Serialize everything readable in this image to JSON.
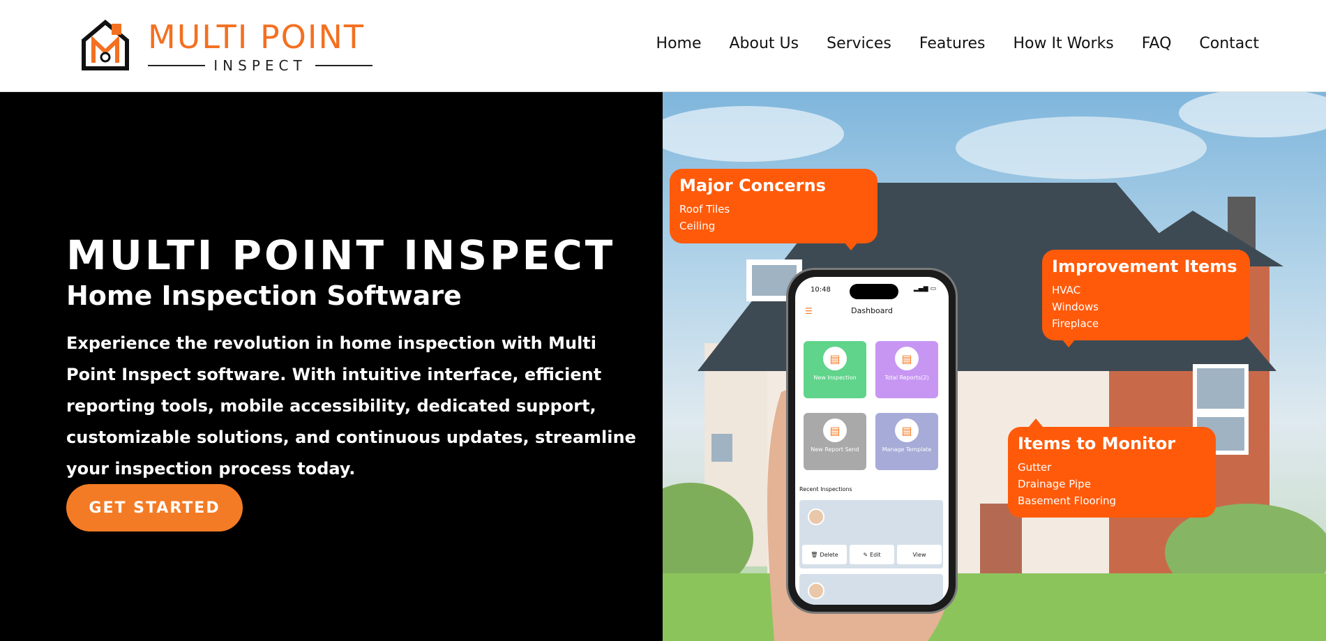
{
  "header": {
    "logo": {
      "name": "MULTI POINT",
      "sub": "INSPECT"
    },
    "nav": [
      "Home",
      "About Us",
      "Services",
      "Features",
      "How It Works",
      "FAQ",
      "Contact"
    ]
  },
  "hero": {
    "title": "MULTI POINT INSPECT",
    "subtitle": "Home Inspection Software",
    "description": "Experience the revolution in home inspection with Multi Point Inspect software. With intuitive interface, efficient reporting tools, mobile accessibility, dedicated support, customizable solutions, and continuous updates, streamline your inspection process today.",
    "cta": "GET STARTED"
  },
  "callouts": {
    "major": {
      "title": "Major Concerns",
      "items": [
        "Roof Tiles",
        "Ceiling"
      ]
    },
    "improvement": {
      "title": "Improvement Items",
      "items": [
        "HVAC",
        "Windows",
        "Fireplace"
      ]
    },
    "monitor": {
      "title": "Items to Monitor",
      "items": [
        "Gutter",
        "Drainage Pipe",
        "Basement Flooring"
      ]
    }
  },
  "phone": {
    "time": "10:48",
    "dashboard_title": "Dashboard",
    "tiles": [
      "New Inspection",
      "Total Reports(2)",
      "New Report Send",
      "Manage Template"
    ],
    "recent_label": "Recent Inspections",
    "actions": [
      "Delete",
      "Edit",
      "View"
    ]
  },
  "colors": {
    "accent": "#f47b25",
    "callout": "#ff5a0a",
    "header_bg": "#ffffff",
    "hero_bg": "#000000"
  }
}
